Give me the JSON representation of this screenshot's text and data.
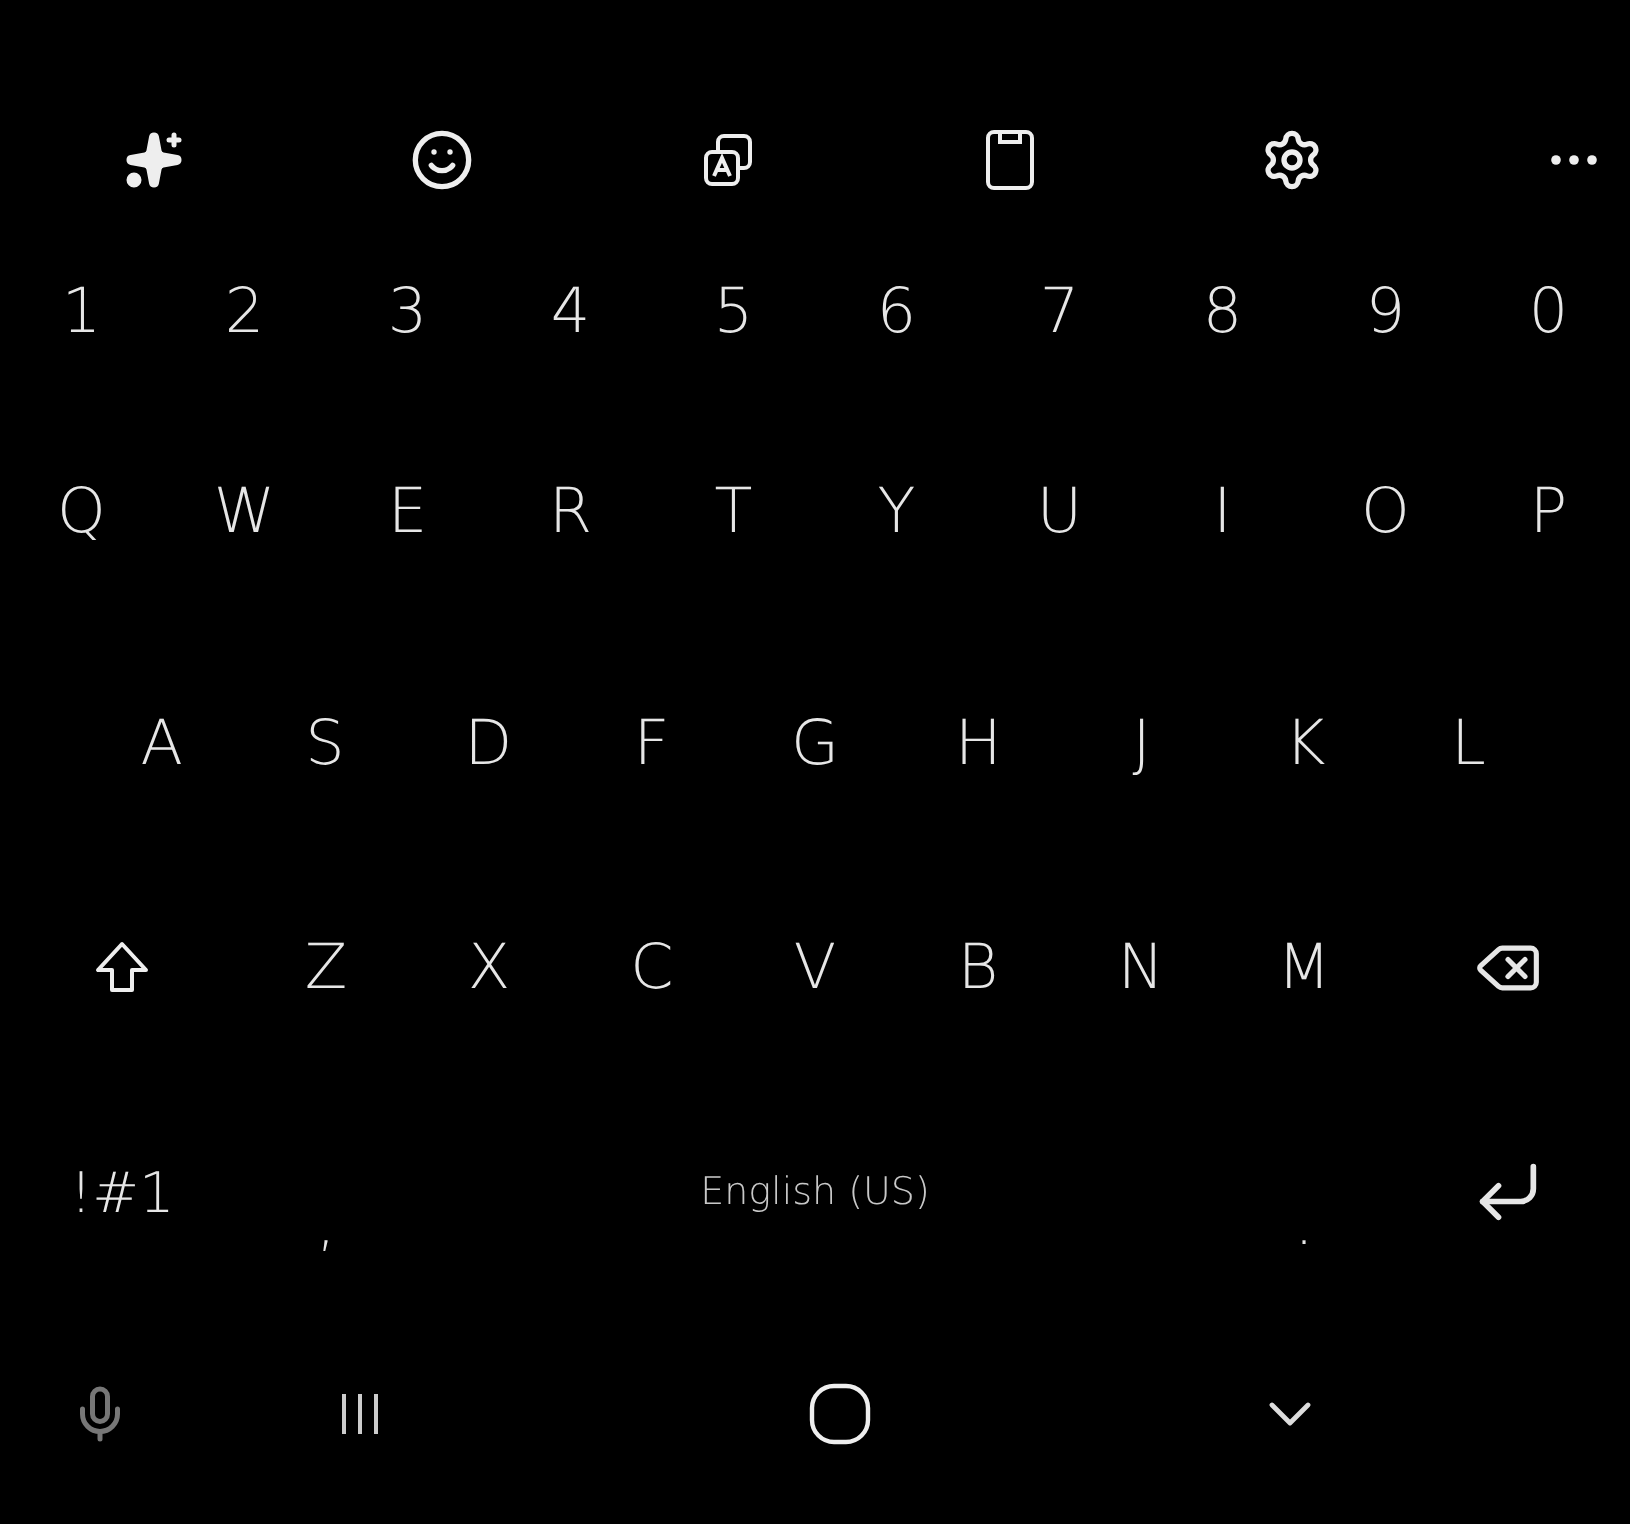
{
  "number_row": [
    {
      "kind": "char",
      "label": "1"
    },
    {
      "kind": "char",
      "label": "2"
    },
    {
      "kind": "char",
      "label": "3"
    },
    {
      "kind": "char",
      "label": "4"
    },
    {
      "kind": "char",
      "label": "5"
    },
    {
      "kind": "char",
      "label": "6"
    },
    {
      "kind": "char",
      "label": "7"
    },
    {
      "kind": "char",
      "label": "8"
    },
    {
      "kind": "char",
      "label": "9"
    },
    {
      "kind": "char",
      "label": "0"
    }
  ],
  "letter_rows": [
    [
      {
        "kind": "char",
        "label": "Q"
      },
      {
        "kind": "char",
        "label": "W"
      },
      {
        "kind": "char",
        "label": "E"
      },
      {
        "kind": "char",
        "label": "R"
      },
      {
        "kind": "char",
        "label": "T"
      },
      {
        "kind": "char",
        "label": "Y"
      },
      {
        "kind": "char",
        "label": "U"
      },
      {
        "kind": "char",
        "label": "I"
      },
      {
        "kind": "char",
        "label": "O"
      },
      {
        "kind": "char",
        "label": "P"
      }
    ],
    [
      {
        "kind": "char",
        "label": "A"
      },
      {
        "kind": "char",
        "label": "S"
      },
      {
        "kind": "char",
        "label": "D"
      },
      {
        "kind": "char",
        "label": "F"
      },
      {
        "kind": "char",
        "label": "G"
      },
      {
        "kind": "char",
        "label": "H"
      },
      {
        "kind": "char",
        "label": "J"
      },
      {
        "kind": "char",
        "label": "K"
      },
      {
        "kind": "char",
        "label": "L"
      }
    ],
    [
      {
        "kind": "shift"
      },
      {
        "kind": "char",
        "label": "Z"
      },
      {
        "kind": "char",
        "label": "X"
      },
      {
        "kind": "char",
        "label": "C"
      },
      {
        "kind": "char",
        "label": "V"
      },
      {
        "kind": "char",
        "label": "B"
      },
      {
        "kind": "char",
        "label": "N"
      },
      {
        "kind": "char",
        "label": "M"
      },
      {
        "kind": "backspace"
      }
    ],
    [
      {
        "kind": "symbols",
        "label": "!#1"
      },
      {
        "kind": "punct",
        "label": ","
      },
      {
        "kind": "space",
        "label": "English (US)"
      },
      {
        "kind": "punct",
        "label": "."
      },
      {
        "kind": "enter"
      }
    ]
  ]
}
